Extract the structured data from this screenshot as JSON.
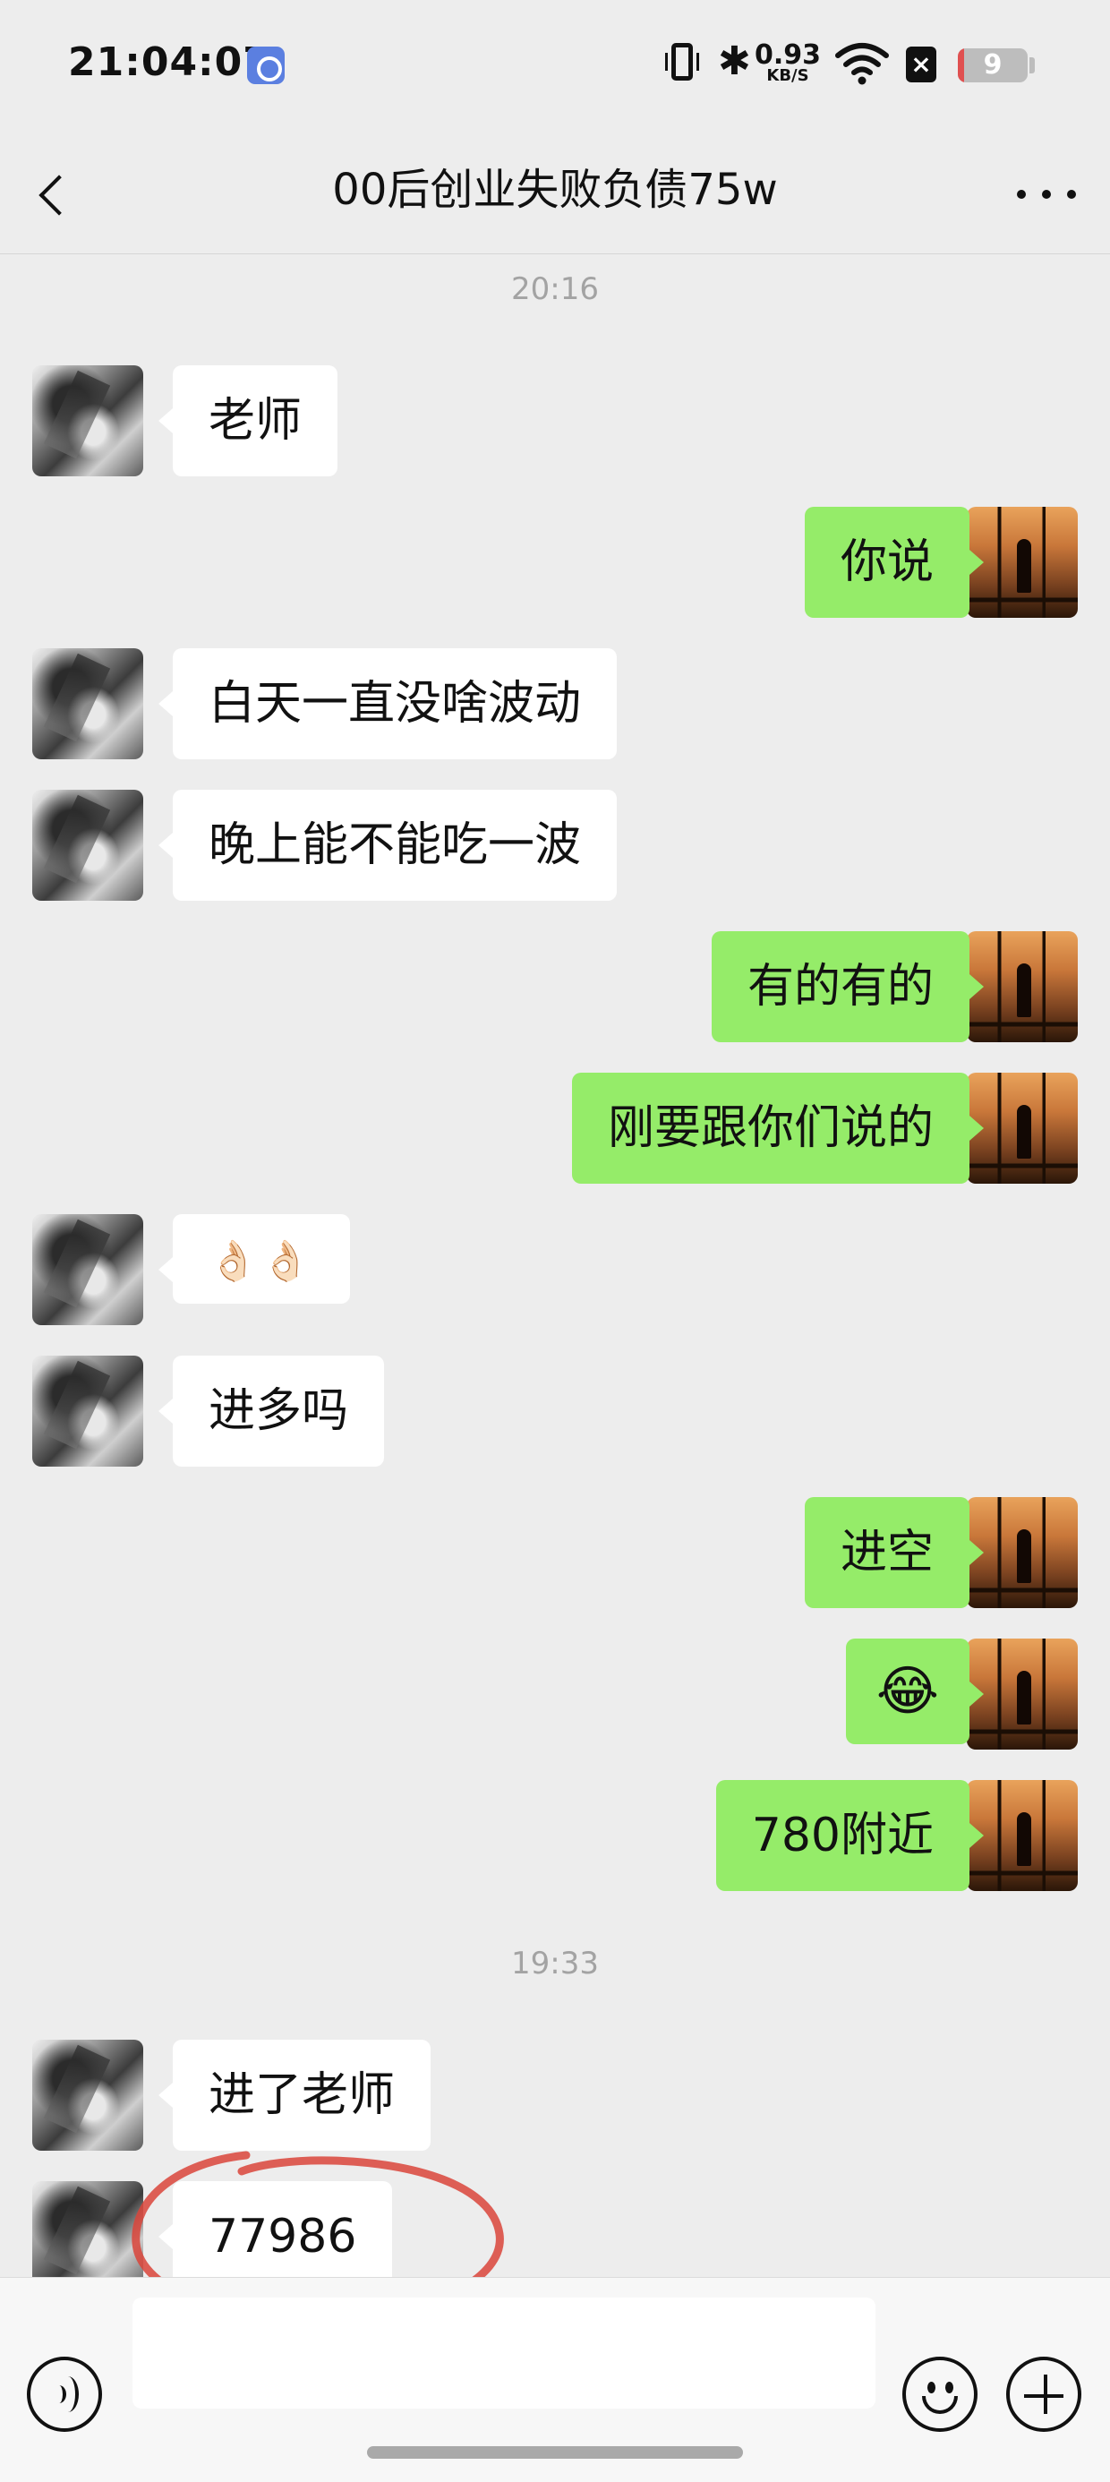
{
  "status_bar": {
    "time": "21:04:07",
    "net_speed_value": "0.93",
    "net_speed_unit": "KB/S",
    "battery_level": "9",
    "battery_fraction": 0.09,
    "icons": [
      "app-notification-icon",
      "vibrate-icon",
      "bluetooth-icon",
      "wifi-icon",
      "no-sim-icon",
      "battery-icon"
    ]
  },
  "header": {
    "title": "00后创业失败负债75w",
    "back_icon": "chevron-left-icon",
    "more_icon": "more-dots-icon"
  },
  "chat": {
    "timestamps": [
      "20:16",
      "19:33"
    ],
    "messages": [
      {
        "side": "in",
        "text": "老师"
      },
      {
        "side": "out",
        "text": "你说"
      },
      {
        "side": "in",
        "text": "白天一直没啥波动"
      },
      {
        "side": "in",
        "text": "晚上能不能吃一波"
      },
      {
        "side": "out",
        "text": "有的有的"
      },
      {
        "side": "out",
        "text": "刚要跟你们说的"
      },
      {
        "side": "in",
        "text": "👌🏻👌🏻"
      },
      {
        "side": "in",
        "text": "进多吗"
      },
      {
        "side": "out",
        "text": "进空"
      },
      {
        "side": "out",
        "text": "😂"
      },
      {
        "side": "out",
        "text": "780附近"
      },
      {
        "side": "in",
        "text": "进了老师"
      },
      {
        "side": "in",
        "text": "77986"
      }
    ],
    "annotation_color": "#d9443a"
  },
  "input_bar": {
    "placeholder": "",
    "voice_icon": "voice-icon",
    "emoji_icon": "emoji-icon",
    "plus_icon": "plus-icon"
  },
  "colors": {
    "background": "#ededed",
    "outgoing_bubble": "#95ec69",
    "incoming_bubble": "#ffffff",
    "timestamp_text": "#a3a3a3"
  }
}
